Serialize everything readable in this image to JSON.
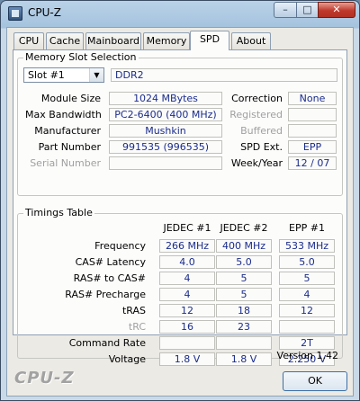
{
  "window": {
    "title": "CPU-Z"
  },
  "titlebar": {
    "min": "–",
    "max": "□",
    "close": "✕"
  },
  "tabs": [
    "CPU",
    "Cache",
    "Mainboard",
    "Memory",
    "SPD",
    "About"
  ],
  "memory_slot": {
    "group_title": "Memory Slot Selection",
    "slot": "Slot #1",
    "type": "DDR2",
    "module_size_label": "Module Size",
    "module_size": "1024 MBytes",
    "max_bandwidth_label": "Max Bandwidth",
    "max_bandwidth": "PC2-6400 (400 MHz)",
    "manufacturer_label": "Manufacturer",
    "manufacturer": "Mushkin",
    "part_number_label": "Part Number",
    "part_number": "991535 (996535)",
    "serial_number_label": "Serial Number",
    "serial_number": "",
    "correction_label": "Correction",
    "correction": "None",
    "registered_label": "Registered",
    "registered": "",
    "buffered_label": "Buffered",
    "buffered": "",
    "spd_ext_label": "SPD Ext.",
    "spd_ext": "EPP",
    "week_year_label": "Week/Year",
    "week_year": "12 / 07"
  },
  "timings": {
    "group_title": "Timings Table",
    "columns": [
      "JEDEC #1",
      "JEDEC #2",
      "EPP #1"
    ],
    "rows": [
      {
        "label": "Frequency",
        "values": [
          "266 MHz",
          "400 MHz",
          "533 MHz"
        ]
      },
      {
        "label": "CAS# Latency",
        "values": [
          "4.0",
          "5.0",
          "5.0"
        ]
      },
      {
        "label": "RAS# to CAS#",
        "values": [
          "4",
          "5",
          "5"
        ]
      },
      {
        "label": "RAS# Precharge",
        "values": [
          "4",
          "5",
          "4"
        ]
      },
      {
        "label": "tRAS",
        "values": [
          "12",
          "18",
          "12"
        ]
      },
      {
        "label": "tRC",
        "values": [
          "16",
          "23",
          ""
        ]
      },
      {
        "label": "Command Rate",
        "values": [
          "",
          "",
          "2T"
        ]
      },
      {
        "label": "Voltage",
        "values": [
          "1.8 V",
          "1.8 V",
          "2.250 V"
        ]
      }
    ]
  },
  "footer": {
    "logo": "CPU-Z",
    "version": "Version 1.42",
    "ok": "OK"
  }
}
